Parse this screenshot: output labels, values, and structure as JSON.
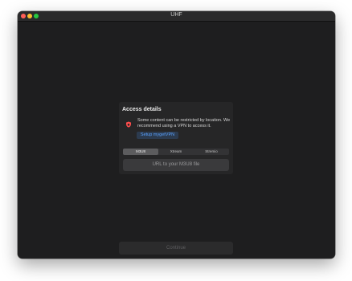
{
  "window": {
    "title": "UHF"
  },
  "access": {
    "heading": "Access details",
    "notice": "Some content can be restricted by location. We recommend using a VPN to access it.",
    "vpn_button": "Setup mygetVPN",
    "tabs": [
      "M3U8",
      "Xtream",
      "Stremio"
    ],
    "active_tab": "M3U8",
    "url_placeholder": "URL to your M3U8 file"
  },
  "footer": {
    "continue_label": "Continue"
  },
  "colors": {
    "window_bg": "#1e1e1f",
    "accent": "#5aa2ff",
    "warning": "#ff4d4d"
  },
  "icons": {
    "warning": "warning-shield-icon"
  }
}
